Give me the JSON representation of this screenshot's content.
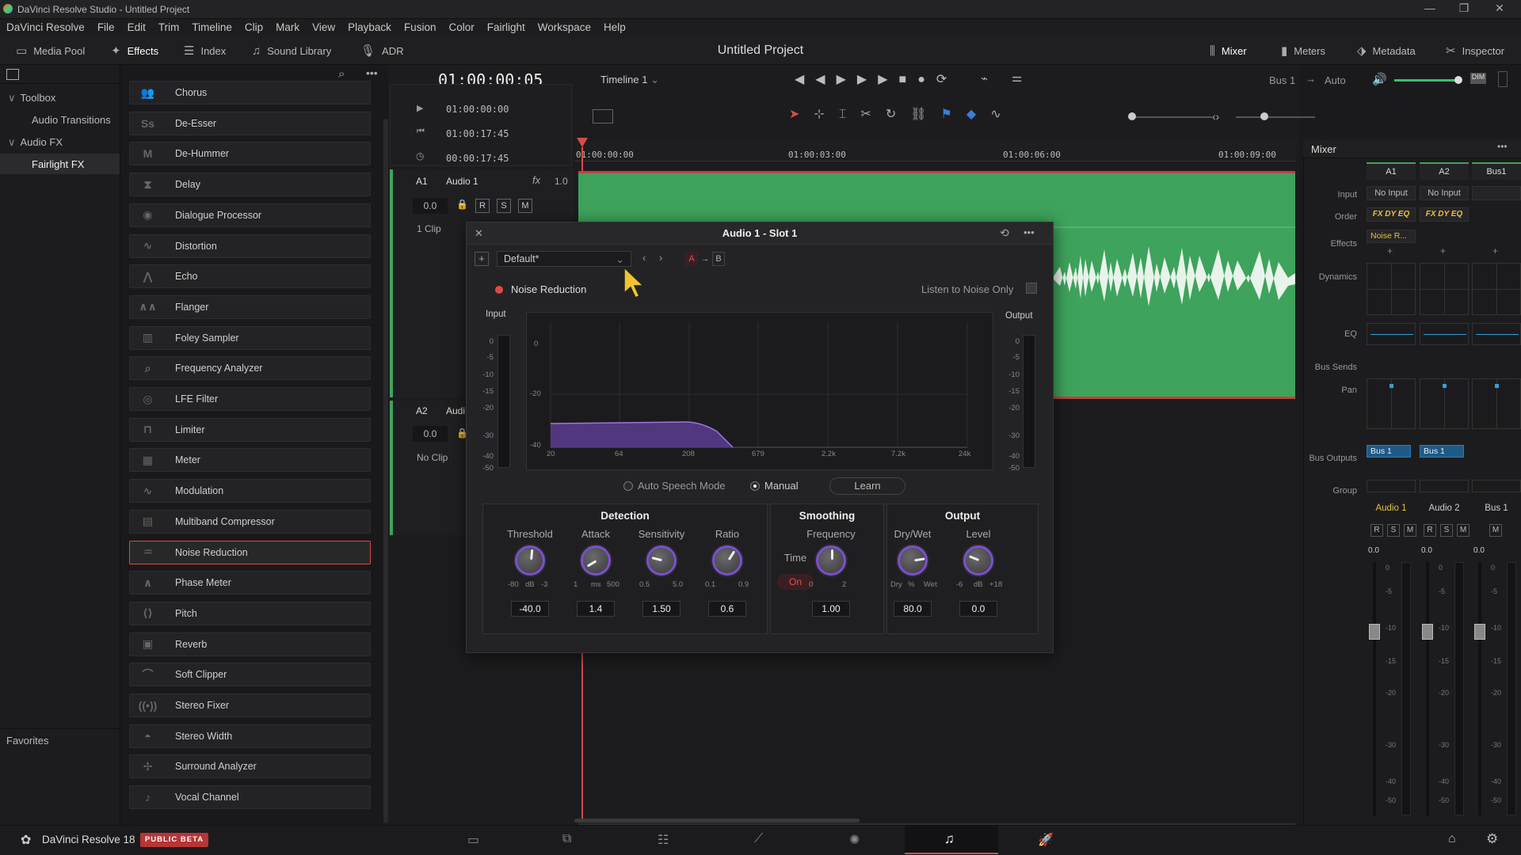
{
  "window": {
    "title": "DaVinci Resolve Studio - Untitled Project"
  },
  "menu": [
    "DaVinci Resolve",
    "File",
    "Edit",
    "Trim",
    "Timeline",
    "Clip",
    "Mark",
    "View",
    "Playback",
    "Fusion",
    "Color",
    "Fairlight",
    "Workspace",
    "Help"
  ],
  "toolbar": {
    "media_pool": "Media Pool",
    "effects": "Effects",
    "index": "Index",
    "sound_library": "Sound Library",
    "adr": "ADR",
    "project_title": "Untitled Project",
    "mixer": "Mixer",
    "meters": "Meters",
    "metadata": "Metadata",
    "inspector": "Inspector"
  },
  "sidebar": {
    "toolbox": "Toolbox",
    "audio_transitions": "Audio Transitions",
    "audio_fx": "Audio FX",
    "fairlight_fx": "Fairlight FX",
    "favorites": "Favorites"
  },
  "effects_list": [
    {
      "name": "Chorus",
      "glyph": "👥"
    },
    {
      "name": "De-Esser",
      "glyph": "Ss"
    },
    {
      "name": "De-Hummer",
      "glyph": "M"
    },
    {
      "name": "Delay",
      "glyph": "⧗"
    },
    {
      "name": "Dialogue Processor",
      "glyph": "◉"
    },
    {
      "name": "Distortion",
      "glyph": "∿"
    },
    {
      "name": "Echo",
      "glyph": "⋀"
    },
    {
      "name": "Flanger",
      "glyph": "∧∧"
    },
    {
      "name": "Foley Sampler",
      "glyph": "▥"
    },
    {
      "name": "Frequency Analyzer",
      "glyph": "⌕"
    },
    {
      "name": "LFE Filter",
      "glyph": "◎"
    },
    {
      "name": "Limiter",
      "glyph": "⊓"
    },
    {
      "name": "Meter",
      "glyph": "▦"
    },
    {
      "name": "Modulation",
      "glyph": "∿"
    },
    {
      "name": "Multiband Compressor",
      "glyph": "▤"
    },
    {
      "name": "Noise Reduction",
      "glyph": "♒"
    },
    {
      "name": "Phase Meter",
      "glyph": "∧"
    },
    {
      "name": "Pitch",
      "glyph": "⟨⟩"
    },
    {
      "name": "Reverb",
      "glyph": "▣"
    },
    {
      "name": "Soft Clipper",
      "glyph": "⌒"
    },
    {
      "name": "Stereo Fixer",
      "glyph": "((•))"
    },
    {
      "name": "Stereo Width",
      "glyph": "◓"
    },
    {
      "name": "Surround Analyzer",
      "glyph": "✢"
    },
    {
      "name": "Vocal Channel",
      "glyph": "♪"
    }
  ],
  "selected_effect": "Noise Reduction",
  "timeline": {
    "timecode": "01:00:00:05",
    "name": "Timeline 1",
    "tc_start": "01:00:00:00",
    "tc_end": "01:00:17:45",
    "tc_dur": "00:00:17:45",
    "ruler": [
      "01:00:00:00",
      "01:00:03:00",
      "01:00:06:00",
      "01:00:09:00"
    ],
    "bus": "Bus 1",
    "auto": "Auto"
  },
  "tracks": [
    {
      "id": "A1",
      "name": "Audio 1",
      "fx": "fx",
      "gain_ratio": "1.0",
      "volume": "0.0",
      "clip_info": "1 Clip"
    },
    {
      "id": "A2",
      "name": "Audi",
      "volume": "0.0",
      "clip_info": "No Clip"
    }
  ],
  "track_buttons": [
    "R",
    "S",
    "M"
  ],
  "plugin": {
    "title": "Audio 1 - Slot 1",
    "preset": "Default*",
    "a": "A",
    "b": "B",
    "arrow": "→",
    "name": "Noise Reduction",
    "listen": "Listen to Noise Only",
    "input": "Input",
    "output": "Output",
    "meter_ticks": [
      "0",
      "-5",
      "-10",
      "-15",
      "-20",
      "-30",
      "-40",
      "-50"
    ],
    "y_ticks": [
      "0",
      "-20",
      "-40"
    ],
    "freq_ticks": [
      "20",
      "64",
      "208",
      "679",
      "2.2k",
      "7.2k",
      "24k"
    ],
    "auto_speech": "Auto Speech Mode",
    "manual": "Manual",
    "learn": "Learn",
    "detection": "Detection",
    "smoothing": "Smoothing",
    "output_sec": "Output",
    "knobs": [
      {
        "label": "Threshold",
        "value": "-40.0",
        "min": "-80",
        "unit": "dB",
        "max": "-3",
        "level": 0.52
      },
      {
        "label": "Attack",
        "value": "1.4",
        "min": "1",
        "unit": "ms",
        "max": "500",
        "level": 0.05
      },
      {
        "label": "Sensitivity",
        "value": "1.50",
        "min": "0.5",
        "unit": "",
        "max": "5.0",
        "level": 0.22
      },
      {
        "label": "Ratio",
        "value": "0.6",
        "min": "0.1",
        "unit": "",
        "max": "0.9",
        "level": 0.62
      },
      {
        "label": "Frequency",
        "value": "1.00",
        "min": "0",
        "unit": "",
        "max": "2",
        "level": 0.5
      },
      {
        "label": "Dry/Wet",
        "value": "80.0",
        "min": "Dry",
        "unit": "%",
        "max": "Wet",
        "level": 0.8
      },
      {
        "label": "Level",
        "value": "0.0",
        "min": "-6",
        "unit": "dB",
        "max": "+18",
        "level": 0.25
      }
    ],
    "time_label": "Time",
    "time_on": "On",
    "level_zero": "0"
  },
  "mixer": {
    "title": "Mixer",
    "cols": [
      "A1",
      "A2",
      "Bus1"
    ],
    "rows": {
      "input": "Input",
      "order": "Order",
      "effects": "Effects",
      "dynamics": "Dynamics",
      "eq": "EQ",
      "bus_sends": "Bus Sends",
      "pan": "Pan",
      "bus_outputs": "Bus Outputs",
      "group": "Group"
    },
    "no_input": "No Input",
    "order_val": "FX DY EQ",
    "effect_val": "Noise R...",
    "bus_out": "Bus 1",
    "plus": "+",
    "channels": [
      "Audio 1",
      "Audio 2",
      "Bus 1"
    ],
    "fader_val": "0.0",
    "fader_ticks": [
      "0",
      "-5",
      "-10",
      "-15",
      "-20",
      "-30",
      "-40",
      "-50"
    ],
    "bus_buttons": [
      "M"
    ]
  },
  "bottom": {
    "app": "DaVinci Resolve 18",
    "beta": "PUBLIC BETA"
  },
  "colors": {
    "accent": "#d94a4a",
    "clip": "#3ea35c",
    "knob": "#7b4fd0",
    "cursor": "#f2c230",
    "tracktitle": "#e8c040"
  }
}
